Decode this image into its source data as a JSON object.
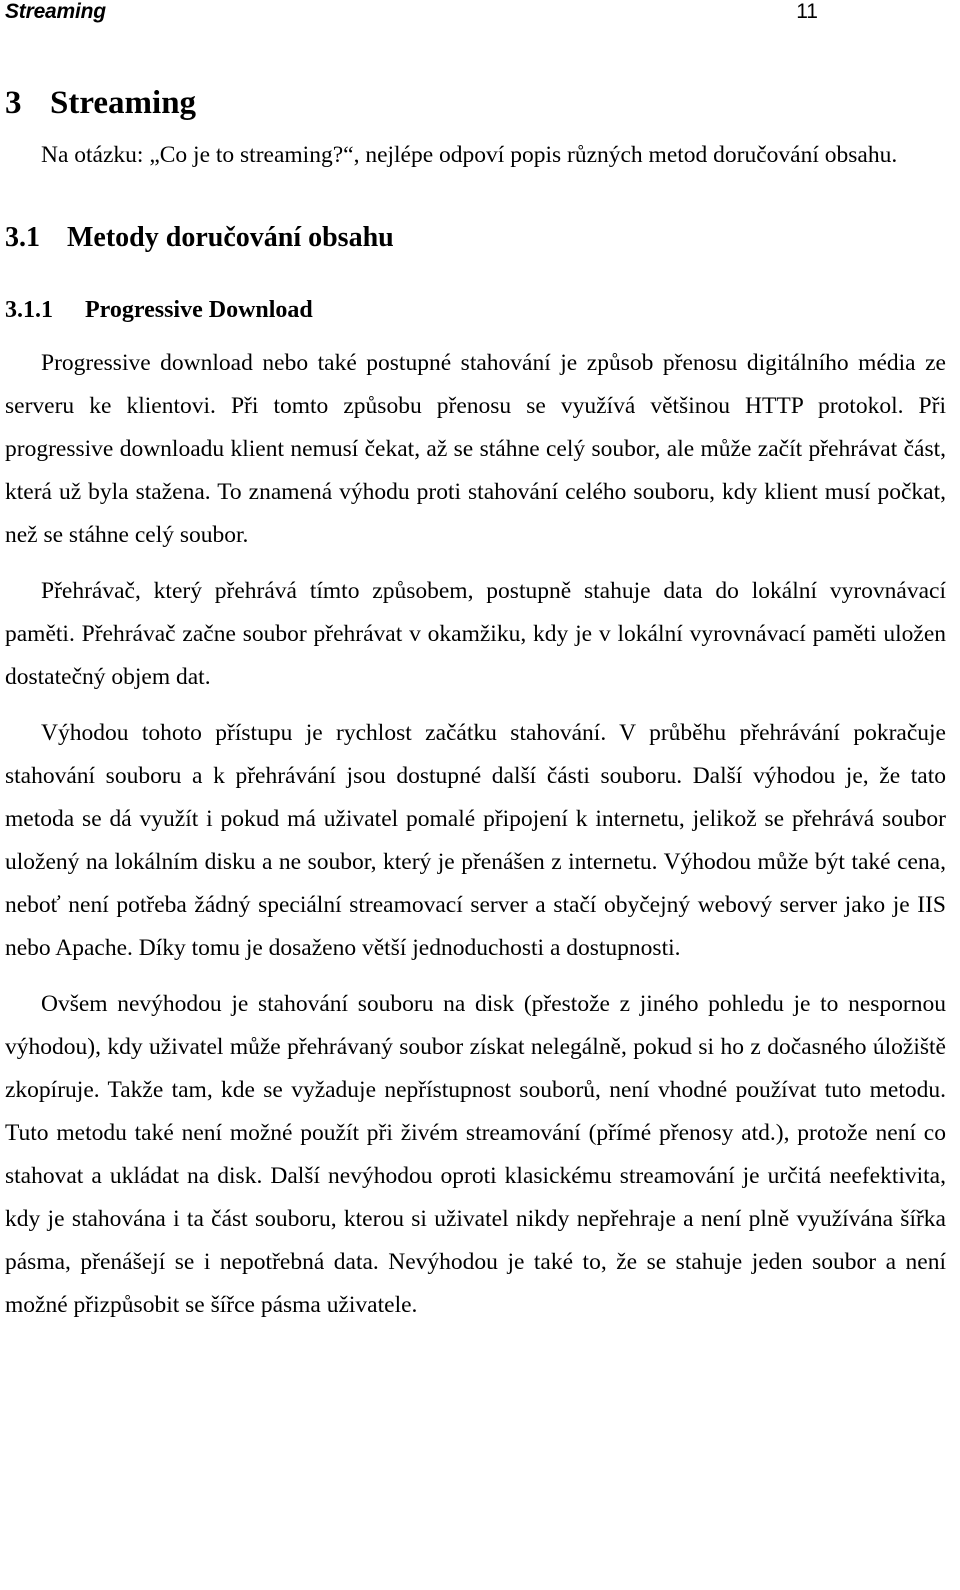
{
  "header": {
    "title": "Streaming",
    "page_number": "11"
  },
  "headings": {
    "h1_number": "3",
    "h1_title": "Streaming",
    "h2_number": "3.1",
    "h2_title": "Metody doručování obsahu",
    "h3_number": "3.1.1",
    "h3_title": "Progressive Download"
  },
  "paragraphs": {
    "p1": "Na otázku: „Co je to streaming?“, nejlépe odpoví popis různých metod doručování obsahu.",
    "p2": "Progressive download nebo také postupné stahování je způsob přenosu digitálního média ze serveru ke klientovi. Při tomto způsobu přenosu se využívá většinou HTTP protokol. Při progressive downloadu klient nemusí čekat, až se stáhne celý soubor, ale může začít přehrávat část, která už byla stažena. To znamená výhodu proti stahování celého souboru, kdy klient musí počkat, než se stáhne celý soubor.",
    "p3": "Přehrávač, který přehrává tímto způsobem, postupně stahuje data do lokální vyrovnávací paměti. Přehrávač začne soubor přehrávat v okamžiku, kdy je v lokální vyrovnávací paměti uložen dostatečný objem dat.",
    "p4": "Výhodou tohoto přístupu je rychlost začátku stahování. V průběhu přehrávání pokračuje stahování souboru a k přehrávání jsou dostupné další části souboru. Další výhodou je, že tato metoda se dá využít i pokud má uživatel pomalé připojení k internetu, jelikož se přehrává soubor uložený na lokálním disku a ne soubor, který je přenášen z internetu. Výhodou může být také cena, neboť není potřeba žádný speciální streamovací server a stačí obyčejný webový server jako je IIS nebo Apache. Díky tomu je dosaženo větší jednoduchosti a dostupnosti.",
    "p5": "Ovšem nevýhodou je stahování souboru na disk (přestože z jiného pohledu je to nespornou výhodou), kdy uživatel může přehrávaný soubor získat nelegálně, pokud si ho z dočasného úložiště zkopíruje. Takže tam, kde se vyžaduje nepřístupnost souborů, není vhodné používat tuto metodu. Tuto metodu také není možné použít při živém streamování (přímé přenosy atd.), protože není co stahovat a ukládat na disk. Další nevýhodou oproti klasickému streamování je určitá neefektivita, kdy je stahována i ta část souboru, kterou si uživatel nikdy nepřehraje a není plně využívána šířka pásma, přenášejí se i nepotřebná data. Nevýhodou je také to, že se stahuje jeden soubor a není možné přizpůsobit se šířce pásma uživatele."
  }
}
